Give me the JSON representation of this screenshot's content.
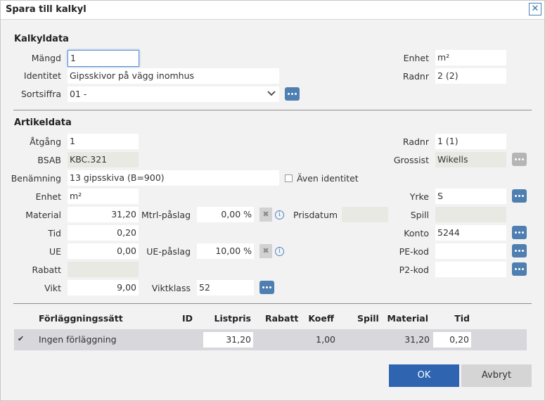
{
  "window": {
    "title": "Spara till kalkyl",
    "close": "✕"
  },
  "kalkyldata": {
    "heading": "Kalkyldata",
    "mangd_label": "Mängd",
    "mangd": "1",
    "identitet_label": "Identitet",
    "identitet": "Gipsskivor på vägg inomhus",
    "sortsiffra_label": "Sortsiffra",
    "sortsiffra": "01 -",
    "enhet_label": "Enhet",
    "enhet": "m²",
    "radnr_label": "Radnr",
    "radnr": "2 (2)"
  },
  "artikeldata": {
    "heading": "Artikeldata",
    "atgang_label": "Åtgång",
    "atgang": "1",
    "bsab_label": "BSAB",
    "bsab": "KBC.321",
    "benamning_label": "Benämning",
    "benamning": "13 gipsskiva (B=900)",
    "aven_identitet_label": "Även identitet",
    "enhet_label": "Enhet",
    "enhet": "m²",
    "material_label": "Material",
    "material": "31,20",
    "mtrl_paslag_label": "Mtrl-påslag",
    "mtrl_paslag": "0,00 %",
    "prisdatum_label": "Prisdatum",
    "prisdatum": "",
    "tid_label": "Tid",
    "tid": "0,20",
    "ue_label": "UE",
    "ue": "0,00",
    "ue_paslag_label": "UE-påslag",
    "ue_paslag": "10,00 %",
    "rabatt_label": "Rabatt",
    "rabatt": "",
    "vikt_label": "Vikt",
    "vikt": "9,00",
    "viktklass_label": "Viktklass",
    "viktklass": "52",
    "radnr_label": "Radnr",
    "radnr": "1 (1)",
    "grossist_label": "Grossist",
    "grossist": "Wikells",
    "yrke_label": "Yrke",
    "yrke": "S",
    "spill_label": "Spill",
    "spill": "",
    "konto_label": "Konto",
    "konto": "5244",
    "pekod_label": "PE-kod",
    "pekod": "",
    "p2kod_label": "P2-kod",
    "p2kod": ""
  },
  "table": {
    "headers": {
      "forlaggning": "Förläggningssätt",
      "id": "ID",
      "listpris": "Listpris",
      "rabatt": "Rabatt",
      "koeff": "Koeff",
      "spill": "Spill",
      "material": "Material",
      "tid": "Tid"
    },
    "row": {
      "checked": true,
      "check_glyph": "✔",
      "forlaggning": "Ingen förläggning",
      "id": "",
      "listpris": "31,20",
      "rabatt": "",
      "koeff": "1,00",
      "spill": "",
      "material": "31,20",
      "tid": "0,20"
    }
  },
  "buttons": {
    "ok": "OK",
    "cancel": "Avbryt"
  },
  "icons": {
    "info": "i",
    "clear": "✖",
    "dropdown": "⌄"
  }
}
